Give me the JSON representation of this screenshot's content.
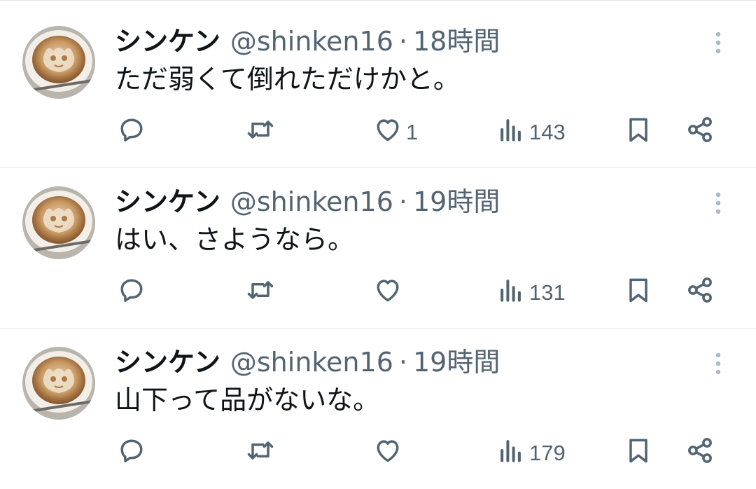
{
  "tweets": [
    {
      "name": "シンケン",
      "handle": "@shinken16",
      "separator": "·",
      "time": "18時間",
      "text": "ただ弱くて倒れただけかと。",
      "replies": "",
      "retweets": "",
      "likes": "1",
      "views": "143"
    },
    {
      "name": "シンケン",
      "handle": "@shinken16",
      "separator": "·",
      "time": "19時間",
      "text": "はい、さようなら。",
      "replies": "",
      "retweets": "",
      "likes": "",
      "views": "131"
    },
    {
      "name": "シンケン",
      "handle": "@shinken16",
      "separator": "·",
      "time": "19時間",
      "text": "山下って品がないな。",
      "replies": "",
      "retweets": "",
      "likes": "",
      "views": "179"
    }
  ],
  "icons": {
    "reply": "reply-icon",
    "retweet": "retweet-icon",
    "like": "heart-icon",
    "views": "views-icon",
    "bookmark": "bookmark-icon",
    "share": "share-icon",
    "more": "more-icon"
  },
  "colors": {
    "text": "#0f1419",
    "secondary": "#536471",
    "divider": "#e7e9ea"
  }
}
